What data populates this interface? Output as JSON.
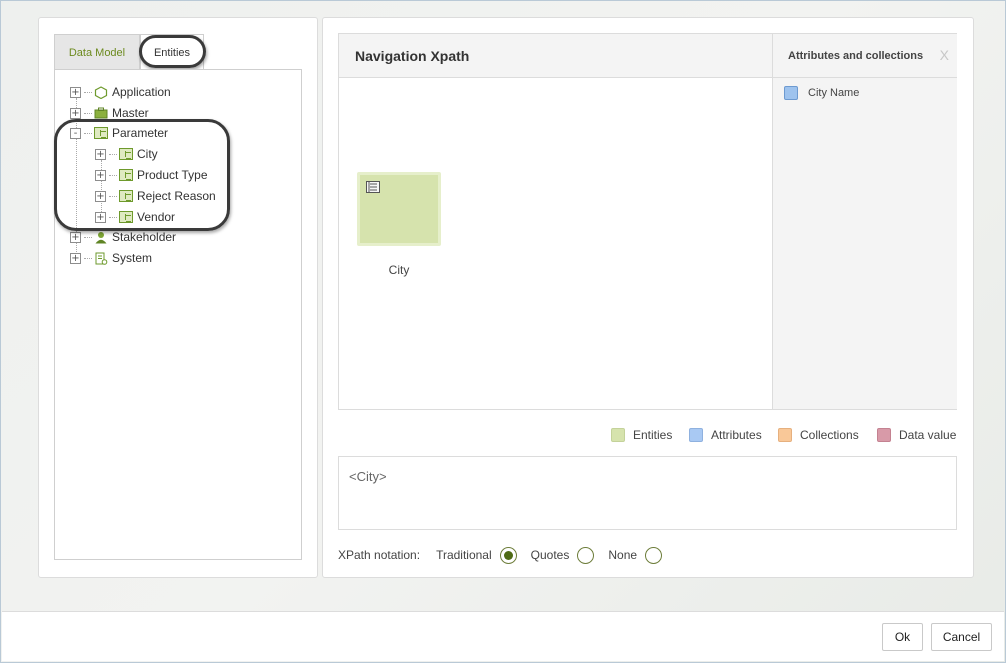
{
  "left_panel": {
    "tabs": [
      {
        "label": "Data Model",
        "active": false
      },
      {
        "label": "Entities",
        "active": true
      }
    ],
    "tree": [
      {
        "label": "Application",
        "toggle": "+",
        "icon": "hexagon-icon"
      },
      {
        "label": "Master",
        "toggle": "+",
        "icon": "briefcase-icon"
      },
      {
        "label": "Parameter",
        "toggle": "-",
        "icon": "entity-table-icon",
        "children": [
          {
            "label": "City",
            "toggle": "+",
            "icon": "entity-table-icon"
          },
          {
            "label": "Product Type",
            "toggle": "+",
            "icon": "entity-table-icon"
          },
          {
            "label": "Reject Reason",
            "toggle": "+",
            "icon": "entity-table-icon"
          },
          {
            "label": "Vendor",
            "toggle": "+",
            "icon": "entity-table-icon"
          }
        ]
      },
      {
        "label": "Stakeholder",
        "toggle": "+",
        "icon": "person-icon"
      },
      {
        "label": "System",
        "toggle": "+",
        "icon": "system-doc-icon"
      }
    ]
  },
  "navigation": {
    "title": "Navigation Xpath",
    "entity_node": {
      "label": "City",
      "icon": "entity-table-icon"
    }
  },
  "attributes_panel": {
    "title": "Attributes and collections",
    "close_label": "X",
    "items": [
      {
        "label": "City Name",
        "color": "#9ec3ee"
      }
    ]
  },
  "legend": [
    {
      "label": "Entities",
      "color": "#d6e3ad"
    },
    {
      "label": "Attributes",
      "color": "#a9c9f3"
    },
    {
      "label": "Collections",
      "color": "#f9c898"
    },
    {
      "label": "Data value",
      "color": "#d89aa8"
    }
  ],
  "xpath": {
    "value": "<City>"
  },
  "notation": {
    "label": "XPath notation:",
    "options": [
      {
        "label": "Traditional",
        "selected": true
      },
      {
        "label": "Quotes",
        "selected": false
      },
      {
        "label": "None",
        "selected": false
      }
    ]
  },
  "footer": {
    "ok_label": "Ok",
    "cancel_label": "Cancel"
  },
  "colors": {
    "accent": "#4f6b15",
    "entity_fill": "#d6e3ad",
    "tab_active_text": "#6c8a1e"
  }
}
